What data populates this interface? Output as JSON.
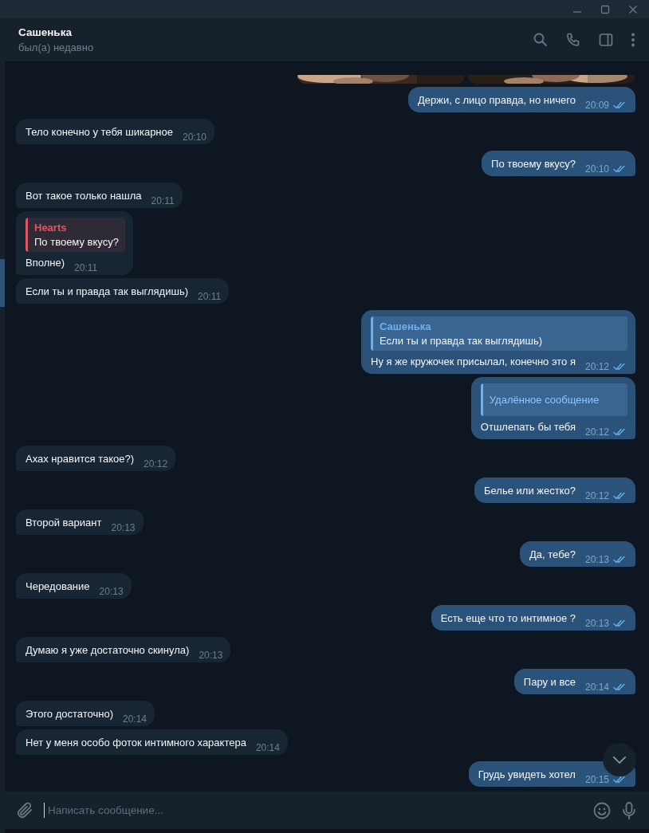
{
  "header": {
    "name": "Сашенька",
    "status": "был(а) недавно"
  },
  "messages": [
    {
      "outgoing": true,
      "text": "Держи, с лицо правда, но ничего",
      "time": "20:09",
      "read": true
    },
    {
      "outgoing": false,
      "text": "Тело конечно у тебя шикарное",
      "time": "20:10"
    },
    {
      "outgoing": true,
      "text": "По твоему вкусу?",
      "time": "20:10",
      "read": true
    },
    {
      "outgoing": false,
      "text": "Вот такое только нашла",
      "time": "20:11"
    },
    {
      "outgoing": false,
      "text": "Вполне)",
      "time": "20:11",
      "reply": {
        "kind": "quote",
        "name": "Hearts",
        "text": "По твоему вкусу?",
        "color": "#e05562"
      }
    },
    {
      "outgoing": false,
      "text": "Если ты и правда так выглядишь)",
      "time": "20:11"
    },
    {
      "outgoing": true,
      "text": "Ну я же кружочек присылал, конечно это я",
      "time": "20:12",
      "read": true,
      "reply": {
        "kind": "quote",
        "name": "Сашенька",
        "text": "Если ты и правда так выглядишь)",
        "color": "#6ab3f3"
      }
    },
    {
      "outgoing": true,
      "text": "Отшлепать бы тебя",
      "time": "20:12",
      "read": true,
      "reply": {
        "kind": "deleted",
        "text": "Удалённое сообщение",
        "color": "#6ab3f3"
      }
    },
    {
      "outgoing": false,
      "text": "Ахах нравится такое?)",
      "time": "20:12"
    },
    {
      "outgoing": true,
      "text": "Белье или жестко?",
      "time": "20:12",
      "read": true
    },
    {
      "outgoing": false,
      "text": "Второй вариант",
      "time": "20:13"
    },
    {
      "outgoing": true,
      "text": "Да, тебе?",
      "time": "20:13",
      "read": true
    },
    {
      "outgoing": false,
      "text": "Чередование",
      "time": "20:13"
    },
    {
      "outgoing": true,
      "text": "Есть еще что то интимное ?",
      "time": "20:13",
      "read": true
    },
    {
      "outgoing": false,
      "text": "Думаю я уже достаточно скинула)",
      "time": "20:13"
    },
    {
      "outgoing": true,
      "text": "Пару и все",
      "time": "20:14",
      "read": true
    },
    {
      "outgoing": false,
      "text": "Этого достаточно)",
      "time": "20:14"
    },
    {
      "outgoing": false,
      "text": "Нет у меня особо фоток интимного характера",
      "time": "20:14"
    },
    {
      "outgoing": true,
      "text": "Грудь увидеть хотел",
      "time": "20:15",
      "read": true
    }
  ],
  "composer": {
    "placeholder": "Написать сообщение..."
  }
}
